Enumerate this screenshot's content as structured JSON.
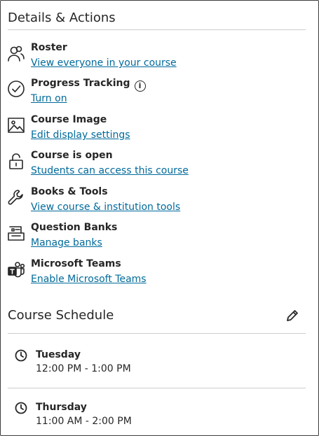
{
  "details": {
    "title": "Details & Actions",
    "items": [
      {
        "icon": "roster-icon",
        "title": "Roster",
        "link": "View everyone in your course"
      },
      {
        "icon": "progress-check-icon",
        "title": "Progress Tracking",
        "link": "Turn on"
      },
      {
        "icon": "image-icon",
        "title": "Course Image",
        "link": "Edit display settings"
      },
      {
        "icon": "unlock-icon",
        "title": "Course is open",
        "link": "Students can access this course"
      },
      {
        "icon": "wrench-icon",
        "title": "Books & Tools",
        "link": "View course & institution tools"
      },
      {
        "icon": "question-bank-icon",
        "title": "Question Banks",
        "link": "Manage banks"
      },
      {
        "icon": "teams-icon",
        "title": "Microsoft Teams",
        "link": "Enable Microsoft Teams"
      }
    ],
    "info_glyph": "i"
  },
  "schedule": {
    "title": "Course Schedule",
    "entries": [
      {
        "day": "Tuesday",
        "time": "12:00 PM - 1:00 PM"
      },
      {
        "day": "Thursday",
        "time": "11:00 AM - 2:00 PM"
      }
    ]
  },
  "colors": {
    "link": "#006a9b",
    "text": "#262626",
    "divider": "#cdcdcd"
  }
}
